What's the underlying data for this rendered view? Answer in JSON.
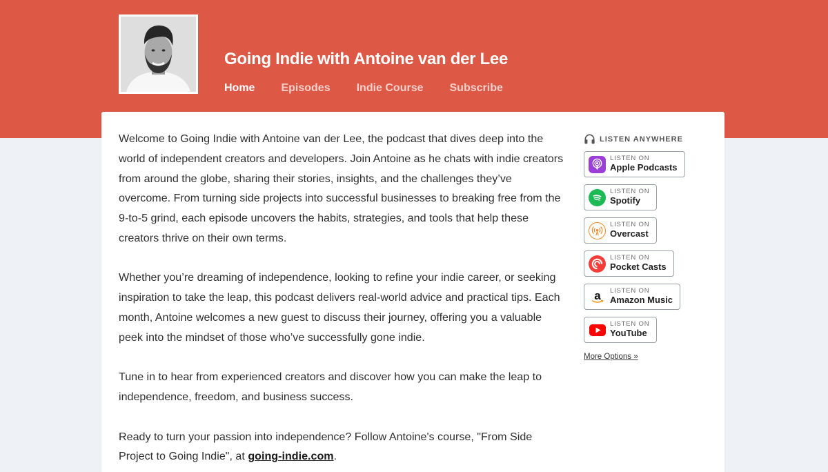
{
  "header": {
    "title": "Going Indie with Antoine van der Lee",
    "nav": [
      {
        "label": "Home",
        "active": true
      },
      {
        "label": "Episodes",
        "active": false
      },
      {
        "label": "Indie Course",
        "active": false
      },
      {
        "label": "Subscribe",
        "active": false
      }
    ],
    "accent_color": "#dd5845"
  },
  "main": {
    "paragraphs": [
      "Welcome to Going Indie with Antoine van der Lee, the podcast that dives deep into the world of independent creators and developers. Join Antoine as he chats with indie creators from around the globe, sharing their stories, insights, and the challenges they’ve overcome. From turning side projects into successful businesses to breaking free from the 9-to-5 grind, each episode uncovers the habits, strategies, and tools that help these creators thrive on their own terms.",
      "Whether you’re dreaming of independence, looking to refine your indie career, or seeking inspiration to take the leap, this podcast delivers real-world advice and practical tips. Each month, Antoine welcomes a new guest to discuss their journey, offering you a valuable peek into the mindset of those who’ve successfully gone indie.",
      "Tune in to hear from experienced creators and discover how you can make the leap to independence, freedom, and business success."
    ],
    "cta_prefix": "Ready to turn your passion into independence? Follow Antoine's course, \"From Side Project to Going Indie\", at ",
    "cta_link": "going-indie.com",
    "cta_suffix": "."
  },
  "sidebar": {
    "heading": "LISTEN ANYWHERE",
    "heading_icon": "headphones-icon",
    "listen_prefix": "LISTEN ON",
    "platforms": [
      {
        "name": "Apple Podcasts",
        "icon": "apple-podcasts-icon",
        "color": "#9b3fd6"
      },
      {
        "name": "Spotify",
        "icon": "spotify-icon",
        "color": "#1db954"
      },
      {
        "name": "Overcast",
        "icon": "overcast-icon",
        "color": "#f08a24"
      },
      {
        "name": "Pocket Casts",
        "icon": "pocket-casts-icon",
        "color": "#f43e37"
      },
      {
        "name": "Amazon Music",
        "icon": "amazon-music-icon",
        "color": "#222222"
      },
      {
        "name": "YouTube",
        "icon": "youtube-icon",
        "color": "#ff0000"
      }
    ],
    "more_options": "More Options »"
  }
}
